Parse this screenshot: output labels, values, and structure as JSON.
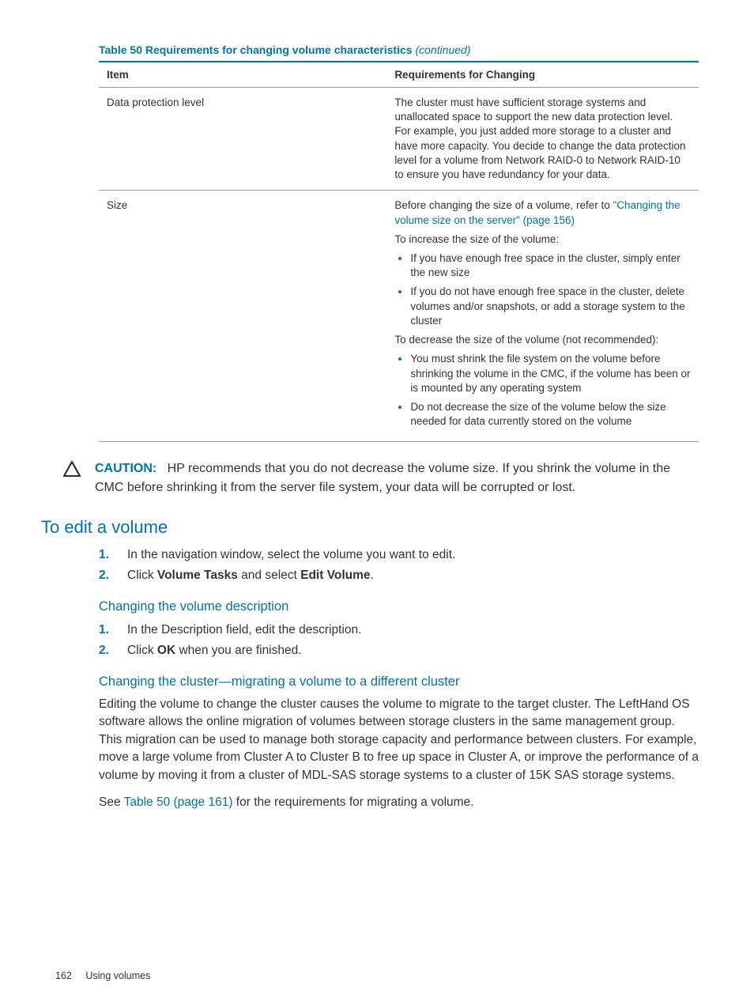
{
  "tableTitle": "Table 50 Requirements for changing volume characteristics",
  "tableTitleContinued": "(continued)",
  "headers": {
    "item": "Item",
    "req": "Requirements for Changing"
  },
  "rows": {
    "dpl": {
      "item": "Data protection level",
      "req": "The cluster must have sufficient storage systems and unallocated space to support the new data protection level. For example, you just added more storage to a cluster and have more capacity. You decide to change the data protection level for a volume from Network RAID-0 to Network RAID-10 to ensure you have redundancy for your data."
    },
    "size": {
      "item": "Size",
      "intro1a": "Before changing the size of a volume, refer to ",
      "intro1link": "\"Changing the volume size on the server\" (page 156)",
      "intro2": "To increase the size of the volume:",
      "inc1": "If you have enough free space in the cluster, simply enter the new size",
      "inc2": "If you do not have enough free space in the cluster, delete volumes and/or snapshots, or add a storage system to the cluster",
      "intro3": "To decrease the size of the volume (not recommended):",
      "dec1": "You must shrink the file system on the volume before shrinking the volume in the CMC, if the volume has been or is mounted by any operating system",
      "dec2": "Do not decrease the size of the volume below the size needed for data currently stored on the volume"
    }
  },
  "caution": {
    "label": "CAUTION:",
    "text": "HP recommends that you do not decrease the volume size. If you shrink the volume in the CMC before shrinking it from the server file system, your data will be corrupted or lost."
  },
  "headings": {
    "editVolume": "To edit a volume",
    "changeDesc": "Changing the volume description",
    "changeCluster": "Changing the cluster—migrating a volume to a different cluster"
  },
  "steps": {
    "edit": {
      "s1": "In the navigation window, select the volume you want to edit.",
      "s2a": "Click ",
      "s2b": "Volume Tasks",
      "s2c": " and select ",
      "s2d": "Edit Volume",
      "s2e": "."
    },
    "desc": {
      "s1": "In the Description field, edit the description.",
      "s2a": "Click ",
      "s2b": "OK",
      "s2c": " when you are finished."
    }
  },
  "clusterPara": "Editing the volume to change the cluster causes the volume to migrate to the target cluster. The LeftHand OS software allows the online migration of volumes between storage clusters in the same management group. This migration can be used to manage both storage capacity and performance between clusters. For example, move a large volume from Cluster A to Cluster B to free up space in Cluster A, or improve the performance of a volume by moving it from a cluster of MDL-SAS storage systems to a cluster of 15K SAS storage systems.",
  "seeRef": {
    "a": "See ",
    "link": "Table 50 (page 161)",
    "b": " for the requirements for migrating a volume."
  },
  "footer": {
    "page": "162",
    "section": "Using volumes"
  }
}
